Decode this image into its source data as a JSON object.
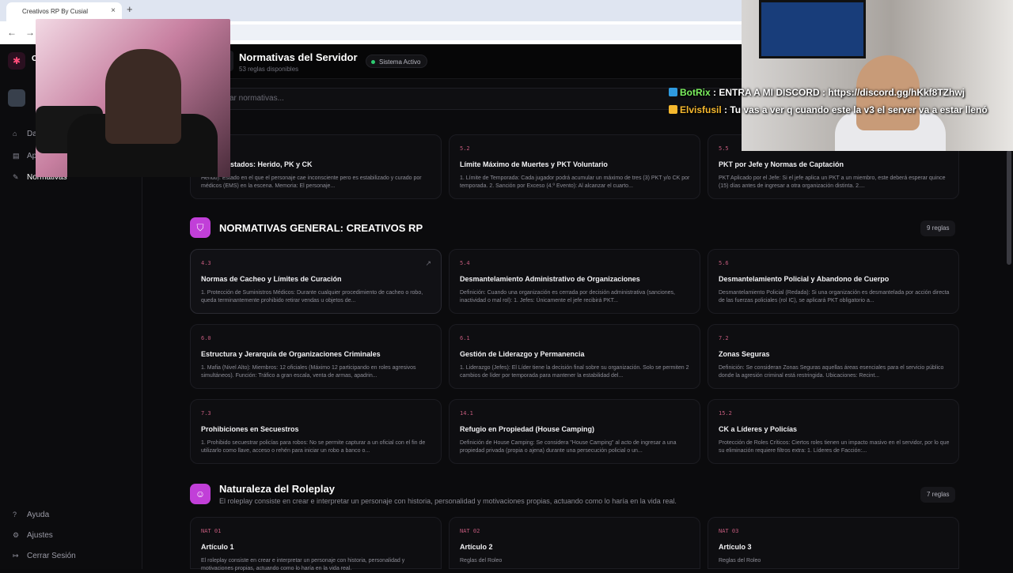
{
  "browser": {
    "tab_title": "Creativos RP By Cusial",
    "tab_close": "×",
    "new_tab": "+",
    "back": "←",
    "forward": "→"
  },
  "sidebar": {
    "logo_letter": "C",
    "items_top": [
      {
        "label": "Da",
        "icon": "dashboard-icon",
        "glyph": "⌂"
      },
      {
        "label": "Ap",
        "icon": "apps-icon",
        "glyph": "▤"
      },
      {
        "label": "Normativas",
        "icon": "gavel-icon",
        "glyph": "✎",
        "active": true
      }
    ],
    "items_bottom": [
      {
        "label": "Ayuda",
        "icon": "help-icon",
        "glyph": "?"
      },
      {
        "label": "Ajustes",
        "icon": "gear-icon",
        "glyph": "⚙"
      },
      {
        "label": "Cerrar Sesión",
        "icon": "logout-icon",
        "glyph": "↦"
      }
    ]
  },
  "header": {
    "title": "Normativas del Servidor",
    "subtitle": "53 reglas disponibles",
    "status": "Sistema Activo"
  },
  "search": {
    "placeholder": "ar normativas..."
  },
  "sections": {
    "top_cards": [
      {
        "code": "",
        "title": "nes de Estados: Herido, PK y CK",
        "desc": "Herido): Estado en el que el personaje cae inconsciente pero es estabilizado y curado por médicos (EMS) en la escena. Memoria: El personaje..."
      },
      {
        "code": "5.2",
        "title": "Límite Máximo de Muertes y PKT Voluntario",
        "desc": "1. Límite de Temporada: Cada jugador podrá acumular un máximo de tres (3) PKT y/o CK por temporada. 2. Sanción por Exceso (4.º Evento): Al alcanzar el cuarto..."
      },
      {
        "code": "5.5",
        "title": "PKT por Jefe y Normas de Captación",
        "desc": "PKT Aplicado por el Jefe: Si el jefe aplica un PKT a un miembro, este deberá esperar quince (15) días antes de ingresar a otra organización distinta. 2...."
      }
    ],
    "general": {
      "title": "NORMATIVAS GENERAL: CREATIVOS RP",
      "count": "9 reglas",
      "cards": [
        {
          "code": "4.3",
          "title": "Normas de Cacheo y Límites de Curación",
          "desc": "1. Protección de Suministros Médicos: Durante cualquier procedimiento de cacheo o robo, queda terminantemente prohibido retirar vendas u objetos de..."
        },
        {
          "code": "5.4",
          "title": "Desmantelamiento Administrativo de Organizaciones",
          "desc": "Definición: Cuando una organización es cerrada por decisión administrativa (sanciones, inactividad o mal rol): 1. Jefes: Únicamente el jefe recibirá PKT..."
        },
        {
          "code": "5.6",
          "title": "Desmantelamiento Policial y Abandono de Cuerpo",
          "desc": "Desmantelamiento Policial (Redada): Si una organización es desmantelada por acción directa de las fuerzas policiales (rol IC), se aplicará PKT obligatorio a..."
        },
        {
          "code": "6.0",
          "title": "Estructura y Jerarquía de Organizaciones Criminales",
          "desc": "1. Mafia (Nivel Alto): Miembros: 12 oficiales (Máximo 12 participando en roles agresivos simultáneos). Función: Tráfico a gran escala, venta de armas, apadrin..."
        },
        {
          "code": "6.1",
          "title": "Gestión de Liderazgo y Permanencia",
          "desc": "1. Liderazgo (Jefes): El Líder tiene la decisión final sobre su organización. Solo se permiten 2 cambios de líder por temporada para mantener la estabilidad del..."
        },
        {
          "code": "7.2",
          "title": "Zonas Seguras",
          "desc": "Definición: Se consideran Zonas Seguras aquellas áreas esenciales para el servicio público donde la agresión criminal está restringida. Ubicaciones: Recint..."
        },
        {
          "code": "7.3",
          "title": "Prohibiciones en Secuestros",
          "desc": "1. Prohibido secuestrar policías para robos: No se permite capturar a un oficial con el fin de utilizarlo como llave, acceso o rehén para iniciar un robo a banco o..."
        },
        {
          "code": "14.1",
          "title": "Refugio en Propiedad (House Camping)",
          "desc": "Definición de House Camping: Se considera \"House Camping\" al acto de ingresar a una propiedad privada (propia o ajena) durante una persecución policial o un..."
        },
        {
          "code": "15.2",
          "title": "CK a Líderes y Policías",
          "desc": "Protección de Roles Críticos: Ciertos roles tienen un impacto masivo en el servidor, por lo que su eliminación requiere filtros extra: 1. Líderes de Facción:..."
        }
      ]
    },
    "naturaleza": {
      "title": "Naturaleza del Roleplay",
      "desc": "El roleplay consiste en crear e interpretar un personaje con historia, personalidad y motivaciones propias, actuando como lo haría en la vida real.",
      "count": "7 reglas",
      "cards": [
        {
          "code": "NAT 01",
          "title": "Artículo 1",
          "desc": "El roleplay consiste en crear e interpretar un personaje con historia, personalidad y motivaciones propias, actuando como lo haría en la vida real."
        },
        {
          "code": "NAT 02",
          "title": "Artículo 2",
          "desc": "Reglas del Roleo"
        },
        {
          "code": "NAT 03",
          "title": "Artículo 3",
          "desc": "Reglas del Roleo"
        }
      ]
    }
  },
  "chat": [
    {
      "user": "BotRix",
      "message": ": ENTRA A MI DISCORD : https://discord.gg/hKkf8TZhwj"
    },
    {
      "user": "Elvisfusil",
      "message": ": Tu vas a ver q cuando este la v3 el server va a estar llenó"
    }
  ],
  "colors": {
    "accent": "#c13fd8",
    "code": "#c25a7c",
    "status_dot": "#2ecc71"
  }
}
